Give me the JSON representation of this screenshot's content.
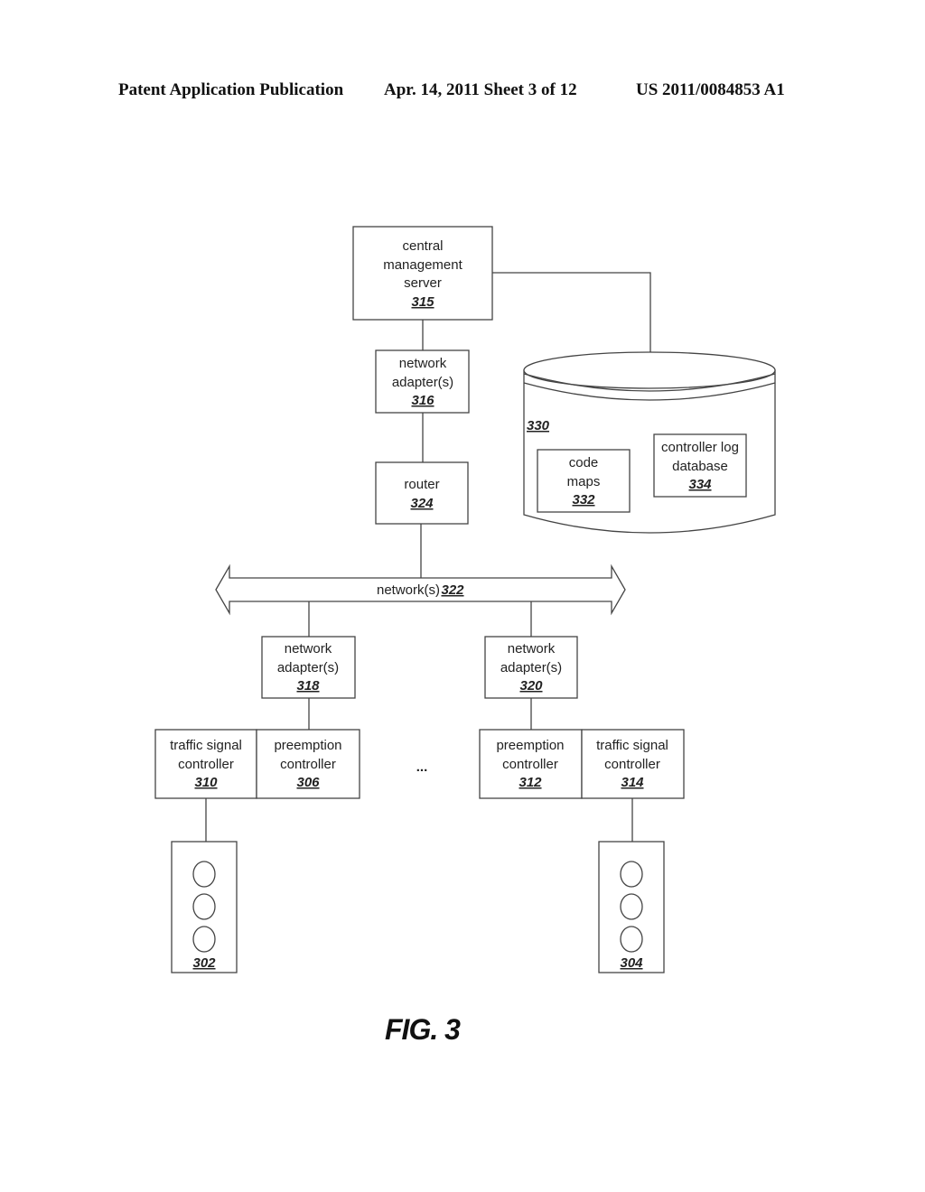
{
  "header": {
    "publication": "Patent Application Publication",
    "date_sheet": "Apr. 14, 2011  Sheet 3 of 12",
    "patent_number": "US 2011/0084853 A1"
  },
  "figure_label": "FIG. 3",
  "nodes": {
    "central_server": {
      "lines": [
        "central",
        "management",
        "server"
      ],
      "ref": "315"
    },
    "adapter_316": {
      "lines": [
        "network",
        "adapter(s)"
      ],
      "ref": "316"
    },
    "router": {
      "lines": [
        "router"
      ],
      "ref": "324"
    },
    "network": {
      "label": "network(s)",
      "ref": "322"
    },
    "database": {
      "ref": "330"
    },
    "code_maps": {
      "lines": [
        "code",
        "maps"
      ],
      "ref": "332"
    },
    "controller_log": {
      "lines": [
        "controller log",
        "database"
      ],
      "ref": "334"
    },
    "adapter_318": {
      "lines": [
        "network",
        "adapter(s)"
      ],
      "ref": "318"
    },
    "adapter_320": {
      "lines": [
        "network",
        "adapter(s)"
      ],
      "ref": "320"
    },
    "tsc_310": {
      "lines": [
        "traffic signal",
        "controller"
      ],
      "ref": "310"
    },
    "pc_306": {
      "lines": [
        "preemption",
        "controller"
      ],
      "ref": "306"
    },
    "pc_312": {
      "lines": [
        "preemption",
        "controller"
      ],
      "ref": "312"
    },
    "tsc_314": {
      "lines": [
        "traffic signal",
        "controller"
      ],
      "ref": "314"
    },
    "signal_302": {
      "ref": "302"
    },
    "signal_304": {
      "ref": "304"
    },
    "ellipsis": "..."
  }
}
